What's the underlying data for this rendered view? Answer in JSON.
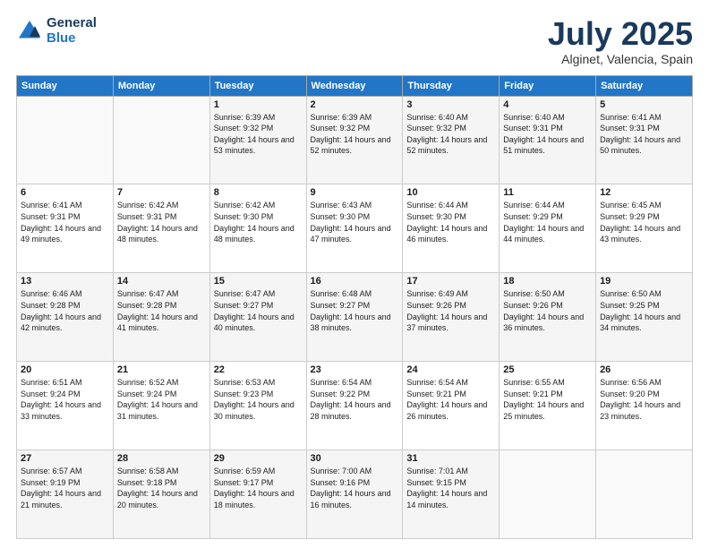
{
  "logo": {
    "general": "General",
    "blue": "Blue"
  },
  "header": {
    "month": "July 2025",
    "location": "Alginet, Valencia, Spain"
  },
  "weekdays": [
    "Sunday",
    "Monday",
    "Tuesday",
    "Wednesday",
    "Thursday",
    "Friday",
    "Saturday"
  ],
  "weeks": [
    [
      {
        "day": "",
        "sunrise": "",
        "sunset": "",
        "daylight": ""
      },
      {
        "day": "",
        "sunrise": "",
        "sunset": "",
        "daylight": ""
      },
      {
        "day": "1",
        "sunrise": "Sunrise: 6:39 AM",
        "sunset": "Sunset: 9:32 PM",
        "daylight": "Daylight: 14 hours and 53 minutes."
      },
      {
        "day": "2",
        "sunrise": "Sunrise: 6:39 AM",
        "sunset": "Sunset: 9:32 PM",
        "daylight": "Daylight: 14 hours and 52 minutes."
      },
      {
        "day": "3",
        "sunrise": "Sunrise: 6:40 AM",
        "sunset": "Sunset: 9:32 PM",
        "daylight": "Daylight: 14 hours and 52 minutes."
      },
      {
        "day": "4",
        "sunrise": "Sunrise: 6:40 AM",
        "sunset": "Sunset: 9:31 PM",
        "daylight": "Daylight: 14 hours and 51 minutes."
      },
      {
        "day": "5",
        "sunrise": "Sunrise: 6:41 AM",
        "sunset": "Sunset: 9:31 PM",
        "daylight": "Daylight: 14 hours and 50 minutes."
      }
    ],
    [
      {
        "day": "6",
        "sunrise": "Sunrise: 6:41 AM",
        "sunset": "Sunset: 9:31 PM",
        "daylight": "Daylight: 14 hours and 49 minutes."
      },
      {
        "day": "7",
        "sunrise": "Sunrise: 6:42 AM",
        "sunset": "Sunset: 9:31 PM",
        "daylight": "Daylight: 14 hours and 48 minutes."
      },
      {
        "day": "8",
        "sunrise": "Sunrise: 6:42 AM",
        "sunset": "Sunset: 9:30 PM",
        "daylight": "Daylight: 14 hours and 48 minutes."
      },
      {
        "day": "9",
        "sunrise": "Sunrise: 6:43 AM",
        "sunset": "Sunset: 9:30 PM",
        "daylight": "Daylight: 14 hours and 47 minutes."
      },
      {
        "day": "10",
        "sunrise": "Sunrise: 6:44 AM",
        "sunset": "Sunset: 9:30 PM",
        "daylight": "Daylight: 14 hours and 46 minutes."
      },
      {
        "day": "11",
        "sunrise": "Sunrise: 6:44 AM",
        "sunset": "Sunset: 9:29 PM",
        "daylight": "Daylight: 14 hours and 44 minutes."
      },
      {
        "day": "12",
        "sunrise": "Sunrise: 6:45 AM",
        "sunset": "Sunset: 9:29 PM",
        "daylight": "Daylight: 14 hours and 43 minutes."
      }
    ],
    [
      {
        "day": "13",
        "sunrise": "Sunrise: 6:46 AM",
        "sunset": "Sunset: 9:28 PM",
        "daylight": "Daylight: 14 hours and 42 minutes."
      },
      {
        "day": "14",
        "sunrise": "Sunrise: 6:47 AM",
        "sunset": "Sunset: 9:28 PM",
        "daylight": "Daylight: 14 hours and 41 minutes."
      },
      {
        "day": "15",
        "sunrise": "Sunrise: 6:47 AM",
        "sunset": "Sunset: 9:27 PM",
        "daylight": "Daylight: 14 hours and 40 minutes."
      },
      {
        "day": "16",
        "sunrise": "Sunrise: 6:48 AM",
        "sunset": "Sunset: 9:27 PM",
        "daylight": "Daylight: 14 hours and 38 minutes."
      },
      {
        "day": "17",
        "sunrise": "Sunrise: 6:49 AM",
        "sunset": "Sunset: 9:26 PM",
        "daylight": "Daylight: 14 hours and 37 minutes."
      },
      {
        "day": "18",
        "sunrise": "Sunrise: 6:50 AM",
        "sunset": "Sunset: 9:26 PM",
        "daylight": "Daylight: 14 hours and 36 minutes."
      },
      {
        "day": "19",
        "sunrise": "Sunrise: 6:50 AM",
        "sunset": "Sunset: 9:25 PM",
        "daylight": "Daylight: 14 hours and 34 minutes."
      }
    ],
    [
      {
        "day": "20",
        "sunrise": "Sunrise: 6:51 AM",
        "sunset": "Sunset: 9:24 PM",
        "daylight": "Daylight: 14 hours and 33 minutes."
      },
      {
        "day": "21",
        "sunrise": "Sunrise: 6:52 AM",
        "sunset": "Sunset: 9:24 PM",
        "daylight": "Daylight: 14 hours and 31 minutes."
      },
      {
        "day": "22",
        "sunrise": "Sunrise: 6:53 AM",
        "sunset": "Sunset: 9:23 PM",
        "daylight": "Daylight: 14 hours and 30 minutes."
      },
      {
        "day": "23",
        "sunrise": "Sunrise: 6:54 AM",
        "sunset": "Sunset: 9:22 PM",
        "daylight": "Daylight: 14 hours and 28 minutes."
      },
      {
        "day": "24",
        "sunrise": "Sunrise: 6:54 AM",
        "sunset": "Sunset: 9:21 PM",
        "daylight": "Daylight: 14 hours and 26 minutes."
      },
      {
        "day": "25",
        "sunrise": "Sunrise: 6:55 AM",
        "sunset": "Sunset: 9:21 PM",
        "daylight": "Daylight: 14 hours and 25 minutes."
      },
      {
        "day": "26",
        "sunrise": "Sunrise: 6:56 AM",
        "sunset": "Sunset: 9:20 PM",
        "daylight": "Daylight: 14 hours and 23 minutes."
      }
    ],
    [
      {
        "day": "27",
        "sunrise": "Sunrise: 6:57 AM",
        "sunset": "Sunset: 9:19 PM",
        "daylight": "Daylight: 14 hours and 21 minutes."
      },
      {
        "day": "28",
        "sunrise": "Sunrise: 6:58 AM",
        "sunset": "Sunset: 9:18 PM",
        "daylight": "Daylight: 14 hours and 20 minutes."
      },
      {
        "day": "29",
        "sunrise": "Sunrise: 6:59 AM",
        "sunset": "Sunset: 9:17 PM",
        "daylight": "Daylight: 14 hours and 18 minutes."
      },
      {
        "day": "30",
        "sunrise": "Sunrise: 7:00 AM",
        "sunset": "Sunset: 9:16 PM",
        "daylight": "Daylight: 14 hours and 16 minutes."
      },
      {
        "day": "31",
        "sunrise": "Sunrise: 7:01 AM",
        "sunset": "Sunset: 9:15 PM",
        "daylight": "Daylight: 14 hours and 14 minutes."
      },
      {
        "day": "",
        "sunrise": "",
        "sunset": "",
        "daylight": ""
      },
      {
        "day": "",
        "sunrise": "",
        "sunset": "",
        "daylight": ""
      }
    ]
  ]
}
